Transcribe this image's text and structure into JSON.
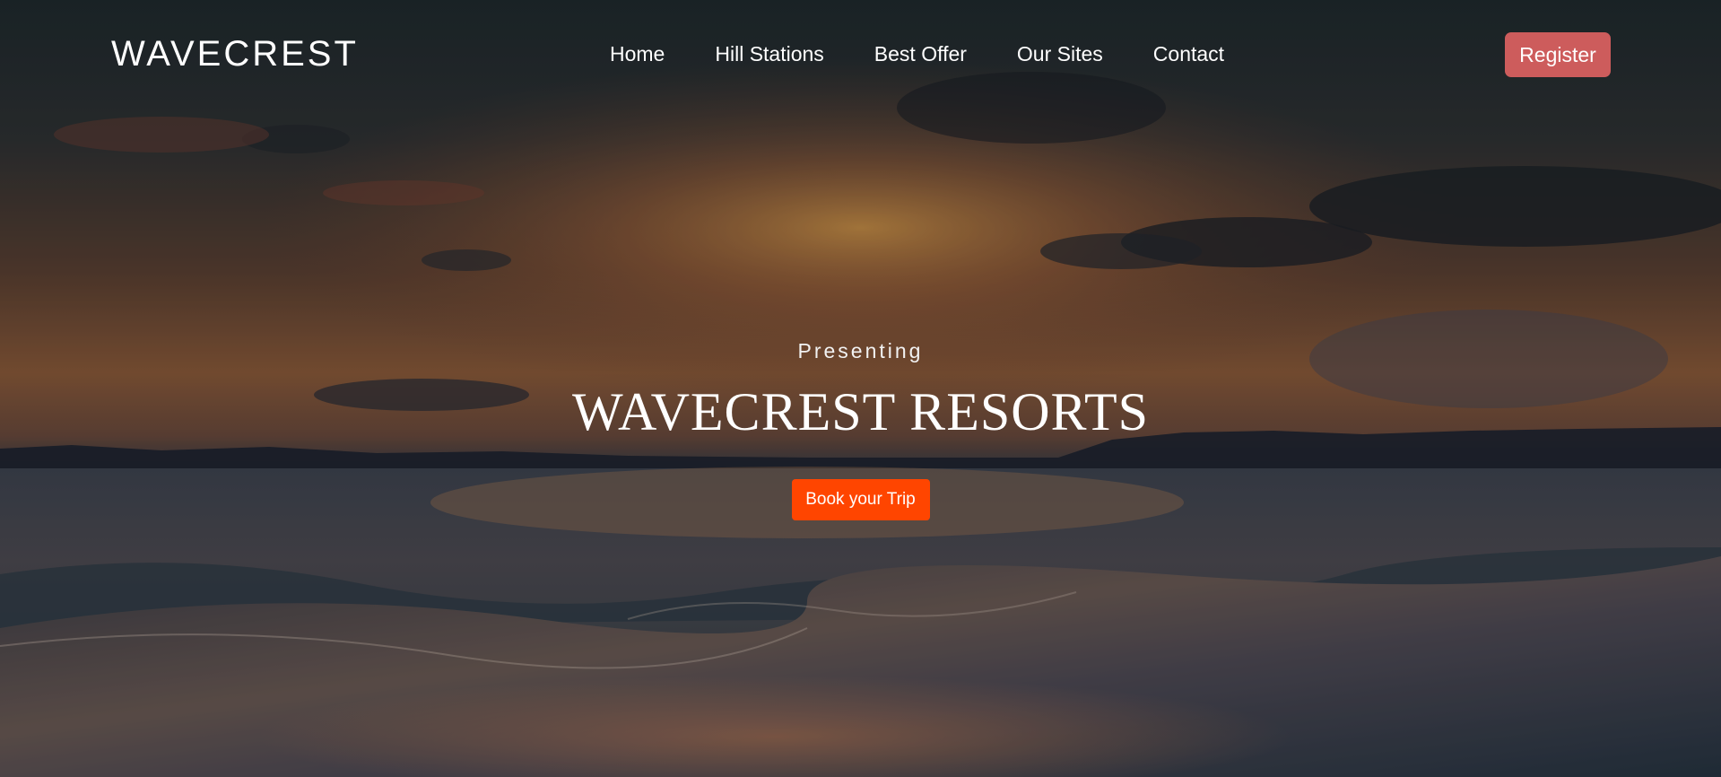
{
  "brand": {
    "logo_text": "WAVECREST"
  },
  "nav": {
    "items": [
      {
        "label": "Home"
      },
      {
        "label": "Hill Stations"
      },
      {
        "label": "Best Offer"
      },
      {
        "label": "Our Sites"
      },
      {
        "label": "Contact"
      }
    ],
    "register_label": "Register"
  },
  "hero": {
    "eyebrow": "Presenting",
    "title": "WAVECREST RESORTS",
    "cta_label": "Book your Trip"
  },
  "colors": {
    "register_button": "#cd5c5c",
    "cta_button": "#ff4500",
    "text": "#ffffff"
  }
}
